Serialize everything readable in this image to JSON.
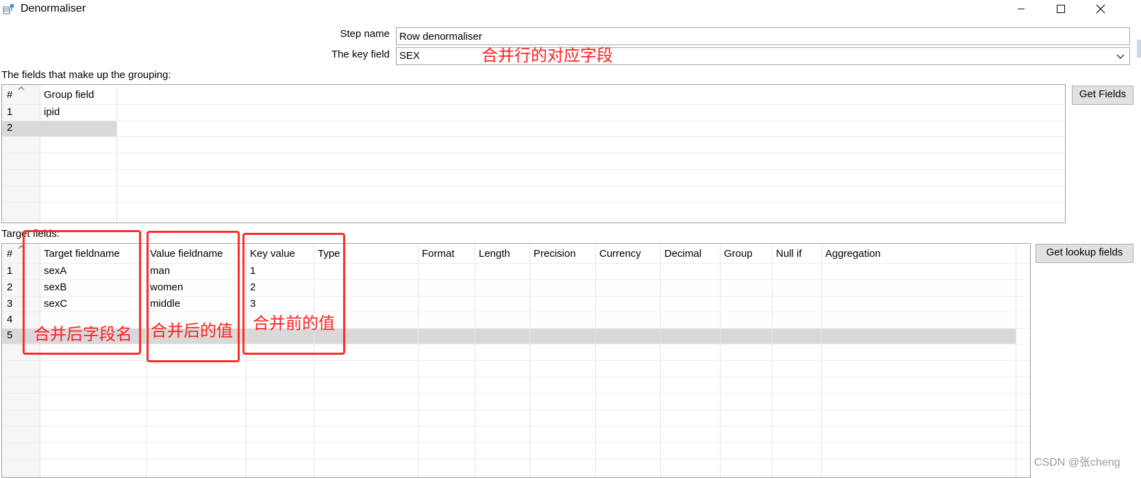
{
  "window": {
    "title": "Denormaliser",
    "icon": "denormaliser-step-icon"
  },
  "form": {
    "step_name_label": "Step name",
    "step_name_value": "Row denormaliser",
    "key_field_label": "The key field",
    "key_field_value": "SEX"
  },
  "grouping": {
    "label": "The fields that make up the grouping:",
    "headers": [
      "#",
      "Group field"
    ],
    "rows": [
      {
        "num": "1",
        "field": "ipid"
      },
      {
        "num": "2",
        "field": ""
      }
    ],
    "get_fields_button": "Get Fields"
  },
  "target": {
    "label": "Target fields:",
    "headers": [
      "#",
      "Target fieldname",
      "Value fieldname",
      "Key value",
      "Type",
      "Format",
      "Length",
      "Precision",
      "Currency",
      "Decimal",
      "Group",
      "Null if",
      "Aggregation"
    ],
    "rows": [
      {
        "num": "1",
        "target": "sexA",
        "value": "man",
        "key": "1"
      },
      {
        "num": "2",
        "target": "sexB",
        "value": "women",
        "key": "2"
      },
      {
        "num": "3",
        "target": "sexC",
        "value": "middle",
        "key": "3"
      },
      {
        "num": "4",
        "target": "",
        "value": "",
        "key": ""
      },
      {
        "num": "5",
        "target": "",
        "value": "",
        "key": ""
      }
    ],
    "get_lookup_button": "Get lookup fields"
  },
  "annotations": {
    "key_field_note": "合并行的对应字段",
    "target_note": "合并后字段名",
    "value_note": "合并后的值",
    "key_value_note": "合并前的值",
    "color": "#ff2a2a"
  },
  "watermark": "CSDN @张cheng"
}
